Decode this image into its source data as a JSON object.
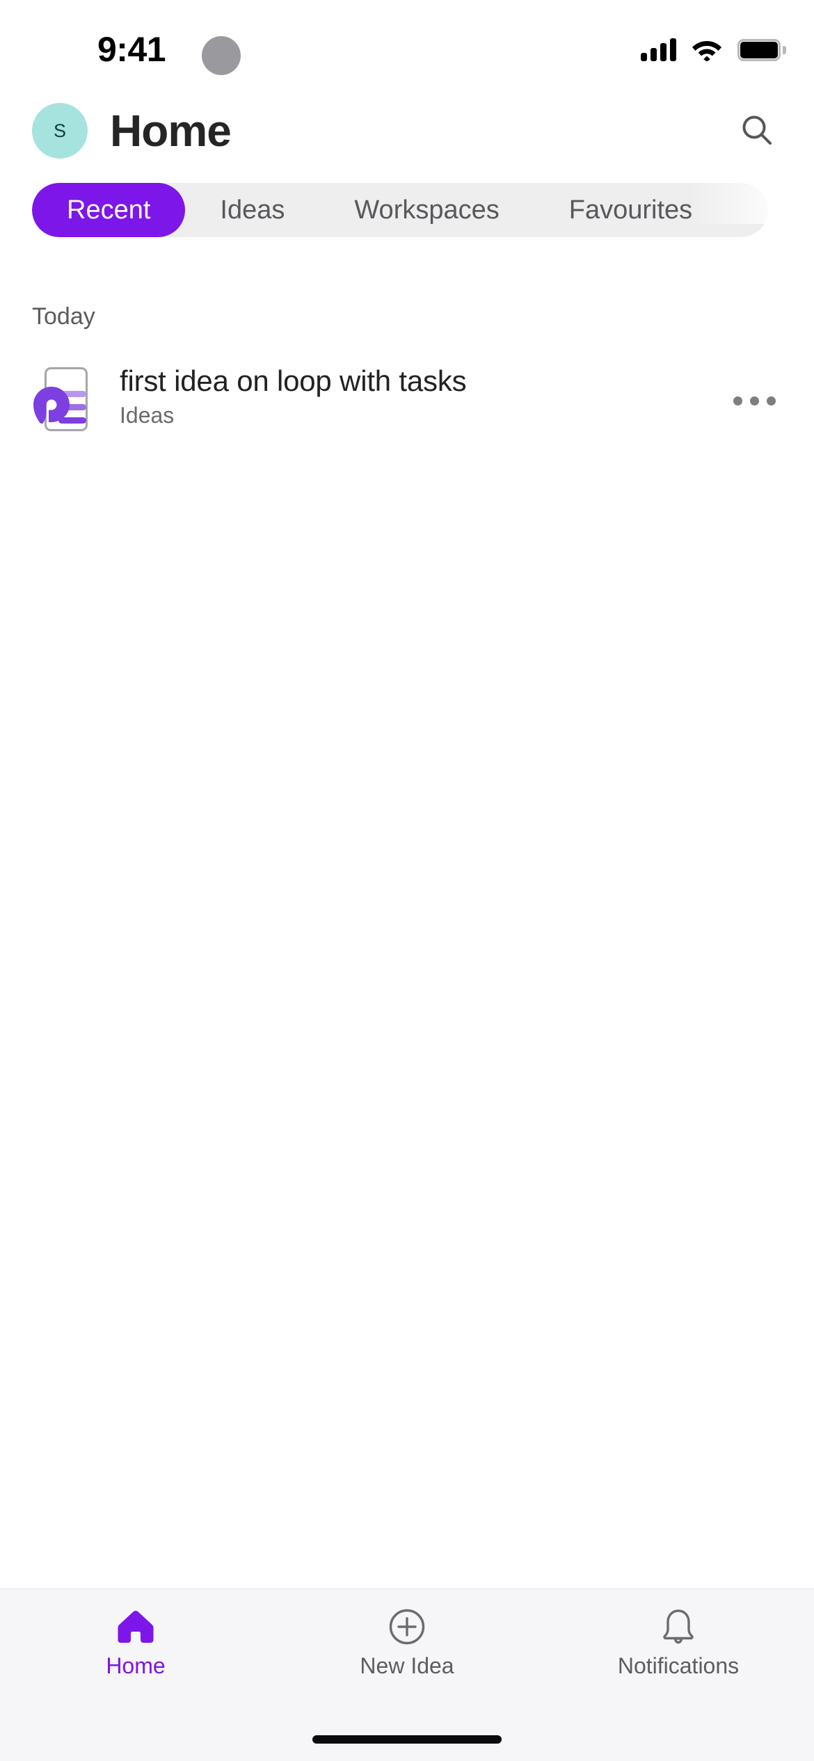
{
  "status_bar": {
    "time": "9:41",
    "signal_icon": "cellular-signal-icon",
    "wifi_icon": "wifi-icon",
    "battery_icon": "battery-icon"
  },
  "header": {
    "avatar_initial": "S",
    "avatar_bg": "#a6e3de",
    "avatar_text_color": "#11403f",
    "title": "Home",
    "search_icon": "search-icon"
  },
  "tabs": {
    "items": [
      {
        "label": "Recent",
        "active": true
      },
      {
        "label": "Ideas",
        "active": false
      },
      {
        "label": "Workspaces",
        "active": false
      },
      {
        "label": "Favourites",
        "active": false
      }
    ],
    "active_bg": "#7d16e8",
    "active_text": "#ffffff",
    "strip_bg": "#eeeeef",
    "inactive_text": "#58585c"
  },
  "content": {
    "sections": [
      {
        "label": "Today",
        "items": [
          {
            "icon": "loop-document-icon",
            "title": "first idea on loop with tasks",
            "subtitle": "Ideas",
            "more_icon": "more-horizontal-icon"
          }
        ]
      }
    ]
  },
  "bottom_nav": {
    "items": [
      {
        "label": "Home",
        "icon": "home-icon",
        "active": true
      },
      {
        "label": "New Idea",
        "icon": "plus-circle-icon",
        "active": false
      },
      {
        "label": "Notifications",
        "icon": "bell-icon",
        "active": false
      }
    ],
    "active_color": "#7d16e8",
    "inactive_color": "#5c5c61",
    "bg": "#f6f5f8"
  },
  "colors": {
    "accent_purple": "#7d16e8",
    "text_primary": "#222224",
    "text_secondary": "#6a6a6e",
    "page_bg": "#ffffff"
  }
}
